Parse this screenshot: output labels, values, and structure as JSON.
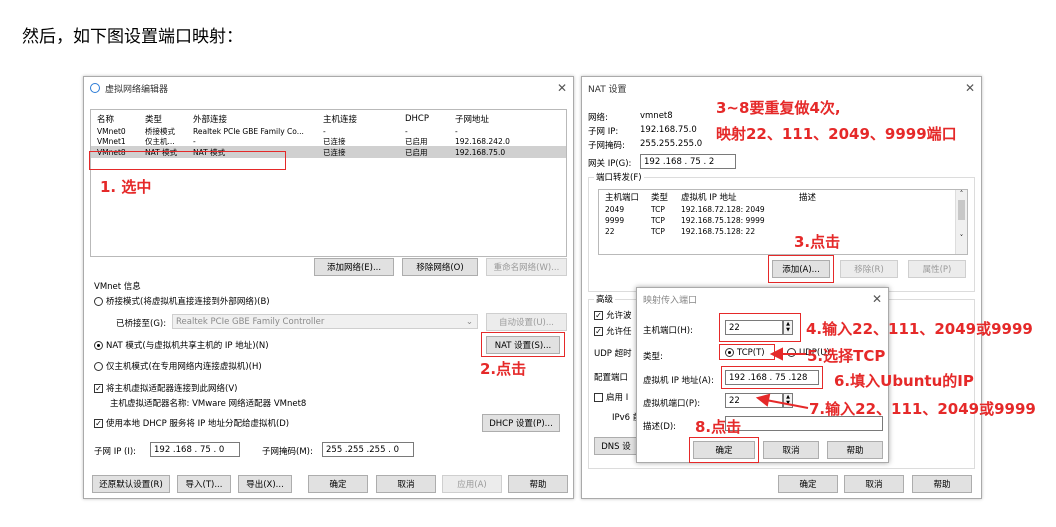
{
  "intro": "然后，如下图设置端口映射：",
  "left": {
    "title": "虚拟网络编辑器",
    "columns": [
      "名称",
      "类型",
      "外部连接",
      "主机连接",
      "DHCP",
      "子网地址"
    ],
    "rows": [
      [
        "VMnet0",
        "桥接模式",
        "Realtek PCIe GBE Family Co...",
        "-",
        "-",
        "-"
      ],
      [
        "VMnet1",
        "仅主机...",
        "-",
        "已连接",
        "已启用",
        "192.168.242.0"
      ],
      [
        "VMnet8",
        "NAT 模式",
        "NAT 模式",
        "已连接",
        "已启用",
        "192.168.75.0"
      ]
    ],
    "add_network": "添加网络(E)...",
    "remove_network": "移除网络(O)",
    "rename_network": "重命名网络(W)...",
    "vmnet_info": "VMnet 信息",
    "bridge_mode": "桥接模式(将虚拟机直接连接到外部网络)(B)",
    "bridged_to_label": "已桥接至(G):",
    "bridged_to_value": "Realtek PCIe GBE Family Controller",
    "auto_settings": "自动设置(U)...",
    "nat_mode": "NAT 模式(与虚拟机共享主机的 IP 地址)(N)",
    "nat_settings": "NAT 设置(S)...",
    "host_only": "仅主机模式(在专用网络内连接虚拟机)(H)",
    "connect_adapter": "将主机虚拟适配器连接到此网络(V)",
    "adapter_name": "主机虚拟适配器名称: VMware 网络适配器 VMnet8",
    "use_dhcp": "使用本地 DHCP 服务将 IP 地址分配给虚拟机(D)",
    "dhcp_settings": "DHCP 设置(P)...",
    "subnet_ip_label": "子网 IP (I):",
    "subnet_ip_value": "192 .168 . 75 . 0",
    "subnet_mask_label": "子网掩码(M):",
    "subnet_mask_value": "255 .255 .255 . 0",
    "restore": "还原默认设置(R)",
    "import": "导入(T)...",
    "export": "导出(X)...",
    "ok": "确定",
    "cancel": "取消",
    "apply": "应用(A)",
    "help": "帮助"
  },
  "right": {
    "title": "NAT 设置",
    "network_label": "网络:",
    "network_value": "vmnet8",
    "subnet_ip_label": "子网 IP:",
    "subnet_ip_value": "192.168.75.0",
    "subnet_mask_label": "子网掩码:",
    "subnet_mask_value": "255.255.255.0",
    "gateway_label": "网关 IP(G):",
    "gateway_value": "192 .168 . 75 . 2",
    "port_forwarding": "端口转发(F)",
    "pf_columns": [
      "主机端口",
      "类型",
      "虚拟机 IP 地址",
      "描述"
    ],
    "pf_rows": [
      [
        "2049",
        "TCP",
        "192.168.72.128: 2049",
        ""
      ],
      [
        "9999",
        "TCP",
        "192.168.75.128: 9999",
        ""
      ],
      [
        "22",
        "TCP",
        "192.168.75.128: 22",
        ""
      ]
    ],
    "add": "添加(A)...",
    "remove": "移除(R)",
    "properties": "属性(P)",
    "advanced": "高级",
    "allow1": "允许波",
    "allow2": "允许任",
    "udp_timeout": "UDP 超时",
    "config_port": "配置端口",
    "enable_ipv6": "启用 I",
    "ipv6_prefix": "IPv6 前",
    "dns": "DNS 设",
    "ok": "确定",
    "cancel": "取消",
    "help": "帮助"
  },
  "mapping": {
    "title": "映射传入端口",
    "host_port_label": "主机端口(H):",
    "host_port_value": "22",
    "type_label": "类型:",
    "tcp": "TCP(T)",
    "udp": "UDP(U)",
    "vm_ip_label": "虚拟机 IP 地址(A):",
    "vm_ip_value": "192 .168 . 75 .128",
    "vm_port_label": "虚拟机端口(P):",
    "vm_port_value": "22",
    "desc_label": "描述(D):",
    "ok": "确定",
    "cancel": "取消",
    "help": "帮助"
  },
  "annotations": {
    "a1": "1. 选中",
    "a2": "2.点击",
    "a3": "3.点击",
    "a38_line1": "3~8要重复做4次,",
    "a38_line2": "映射22、111、2049、9999端口",
    "a4": "4.输入22、111、2049或9999",
    "a5": "5.选择TCP",
    "a6": "6.填入Ubuntu的IP",
    "a7": "7.输入22、111、2049或9999",
    "a8": "8.点击"
  },
  "colors": {
    "annotation": "#e52929",
    "selected_row": "#d0d0d0",
    "button_bg": "#e1e1e1"
  }
}
